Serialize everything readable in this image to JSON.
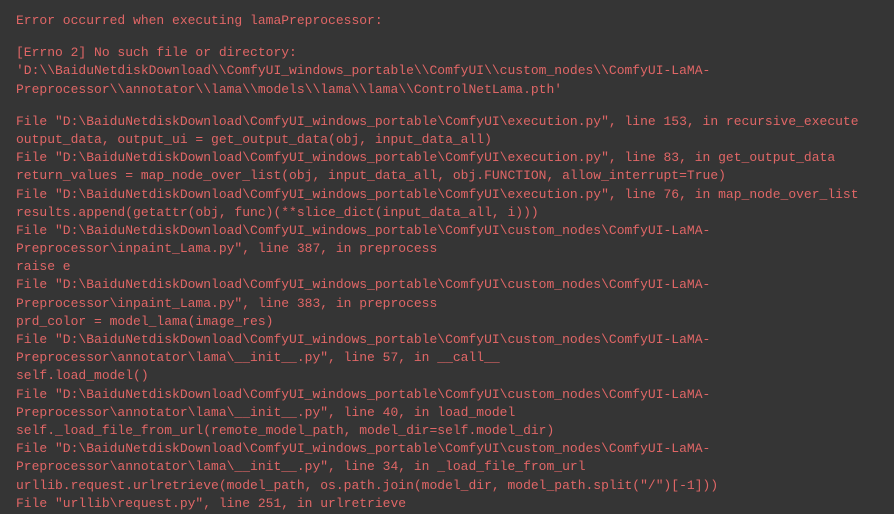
{
  "error": {
    "title": "Error occurred when executing lamaPreprocessor:",
    "errno": "[Errno 2] No such file or directory:",
    "path": "'D:\\\\BaiduNetdiskDownload\\\\ComfyUI_windows_portable\\\\ComfyUI\\\\custom_nodes\\\\ComfyUI-LaMA-Preprocessor\\\\annotator\\\\lama\\\\models\\\\lama\\\\lama\\\\ControlNetLama.pth'"
  },
  "traceback": [
    "File \"D:\\BaiduNetdiskDownload\\ComfyUI_windows_portable\\ComfyUI\\execution.py\", line 153, in recursive_execute",
    "output_data, output_ui = get_output_data(obj, input_data_all)",
    "File \"D:\\BaiduNetdiskDownload\\ComfyUI_windows_portable\\ComfyUI\\execution.py\", line 83, in get_output_data",
    "return_values = map_node_over_list(obj, input_data_all, obj.FUNCTION, allow_interrupt=True)",
    "File \"D:\\BaiduNetdiskDownload\\ComfyUI_windows_portable\\ComfyUI\\execution.py\", line 76, in map_node_over_list",
    "results.append(getattr(obj, func)(**slice_dict(input_data_all, i)))",
    "File \"D:\\BaiduNetdiskDownload\\ComfyUI_windows_portable\\ComfyUI\\custom_nodes\\ComfyUI-LaMA-Preprocessor\\inpaint_Lama.py\", line 387, in preprocess",
    "raise e",
    "File \"D:\\BaiduNetdiskDownload\\ComfyUI_windows_portable\\ComfyUI\\custom_nodes\\ComfyUI-LaMA-Preprocessor\\inpaint_Lama.py\", line 383, in preprocess",
    "prd_color = model_lama(image_res)",
    "File \"D:\\BaiduNetdiskDownload\\ComfyUI_windows_portable\\ComfyUI\\custom_nodes\\ComfyUI-LaMA-Preprocessor\\annotator\\lama\\__init__.py\", line 57, in __call__",
    "self.load_model()",
    "File \"D:\\BaiduNetdiskDownload\\ComfyUI_windows_portable\\ComfyUI\\custom_nodes\\ComfyUI-LaMA-Preprocessor\\annotator\\lama\\__init__.py\", line 40, in load_model",
    "self._load_file_from_url(remote_model_path, model_dir=self.model_dir)",
    "File \"D:\\BaiduNetdiskDownload\\ComfyUI_windows_portable\\ComfyUI\\custom_nodes\\ComfyUI-LaMA-Preprocessor\\annotator\\lama\\__init__.py\", line 34, in _load_file_from_url",
    "urllib.request.urlretrieve(model_path, os.path.join(model_dir, model_path.split(\"/\")[-1]))",
    "File \"urllib\\request.py\", line 251, in urlretrieve"
  ]
}
